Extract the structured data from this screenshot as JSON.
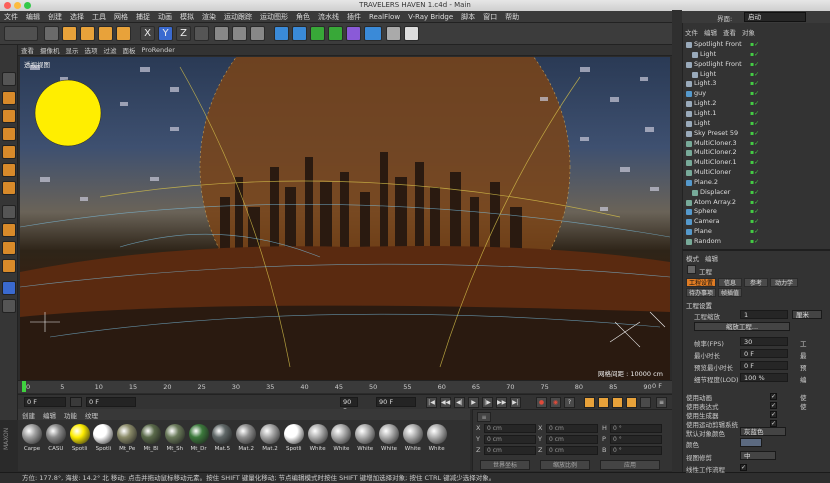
{
  "window": {
    "title": "TRAVELERS HAVEN 1.c4d - Main"
  },
  "menu": [
    "文件",
    "编辑",
    "创建",
    "选择",
    "工具",
    "网格",
    "捕捉",
    "动画",
    "模拟",
    "渲染",
    "运动跟踪",
    "运动图形",
    "角色",
    "流水线",
    "插件",
    "RealFlow",
    "V-Ray Bridge",
    "脚本",
    "窗口",
    "帮助"
  ],
  "interface": {
    "label": "界面:",
    "value": "启动"
  },
  "viewport": {
    "menu": [
      "查看",
      "摄像机",
      "显示",
      "选项",
      "过滤",
      "面板",
      "ProRender"
    ],
    "label": "透视视图",
    "grid_spacing": "网格间距 : 10000 cm"
  },
  "timeline": {
    "ticks": [
      "0",
      "5",
      "10",
      "15",
      "20",
      "25",
      "30",
      "35",
      "40",
      "45",
      "50",
      "55",
      "60",
      "65",
      "70",
      "75",
      "80",
      "85",
      "90"
    ],
    "end_label": "0 F",
    "current_frame": "0 F",
    "start_field": "0 F",
    "end_field": "90 F",
    "end_field2": "90 F"
  },
  "materials": {
    "tabs": [
      "创建",
      "编辑",
      "功能",
      "纹理"
    ],
    "items": [
      {
        "name": "Carpe",
        "color": "#a0a0a0"
      },
      {
        "name": "CASU",
        "color": "#8a8a8a"
      },
      {
        "name": "Spotli",
        "color": "#ffee00"
      },
      {
        "name": "Spotli",
        "color": "#ffffff"
      },
      {
        "name": "Mt_Pe",
        "color": "#8c8c6a"
      },
      {
        "name": "Mt_Bl",
        "color": "#5a6a4a"
      },
      {
        "name": "Mt_Sh",
        "color": "#6a7a5a"
      },
      {
        "name": "Mt_Dr",
        "color": "#3c7a3c"
      },
      {
        "name": "Mat.5",
        "color": "#606868"
      },
      {
        "name": "Mat.2",
        "color": "#909090"
      },
      {
        "name": "Mat.2",
        "color": "#a8a8a8"
      },
      {
        "name": "Spotli",
        "color": "#ffffff"
      },
      {
        "name": "White",
        "color": "#b0b0b0"
      },
      {
        "name": "White",
        "color": "#b0b0b0"
      },
      {
        "name": "White",
        "color": "#b0b0b0"
      },
      {
        "name": "White",
        "color": "#b0b0b0"
      },
      {
        "name": "White",
        "color": "#b0b0b0"
      },
      {
        "name": "White",
        "color": "#b0b0b0"
      }
    ],
    "brand": "MAXON"
  },
  "coordinates": {
    "rows": [
      {
        "a": "X",
        "av": "0 cm",
        "b": "X",
        "bv": "0 cm",
        "c": "H",
        "cv": "0 °"
      },
      {
        "a": "Y",
        "av": "0 cm",
        "b": "Y",
        "bv": "0 cm",
        "c": "P",
        "cv": "0 °"
      },
      {
        "a": "Z",
        "av": "0 cm",
        "b": "Z",
        "bv": "0 cm",
        "c": "B",
        "cv": "0 °"
      }
    ],
    "mode1": "世界坐标",
    "mode2": "缩放比例",
    "apply": "应用"
  },
  "status": "方位: 177.8°, 海拔: 14.2° 北   移动: 点击并拖动鼠标移动元素。按住 SHIFT 键量化移动; 节点编辑模式时按住 SHIFT 键增加选择对象; 按住 CTRL 键减少选择对象。",
  "objects": {
    "menu": [
      "文件",
      "编辑",
      "查看",
      "对象"
    ],
    "items": [
      {
        "name": "Spotlight Front",
        "indent": 0,
        "sel": false
      },
      {
        "name": "Light",
        "indent": 1,
        "sel": false
      },
      {
        "name": "Spotlight Front",
        "indent": 0,
        "sel": false
      },
      {
        "name": "Light",
        "indent": 1,
        "sel": false
      },
      {
        "name": "Light.3",
        "indent": 0,
        "sel": false
      },
      {
        "name": "guy",
        "indent": 0,
        "sel": false
      },
      {
        "name": "Light.2",
        "indent": 0,
        "sel": false
      },
      {
        "name": "Light.1",
        "indent": 0,
        "sel": false
      },
      {
        "name": "Light",
        "indent": 0,
        "sel": false
      },
      {
        "name": "Sky Preset 59",
        "indent": 0,
        "sel": false
      },
      {
        "name": "MultiCloner.3",
        "indent": 0,
        "sel": false
      },
      {
        "name": "MultiCloner.2",
        "indent": 0,
        "sel": false
      },
      {
        "name": "MultiCloner.1",
        "indent": 0,
        "sel": false
      },
      {
        "name": "MultiCloner",
        "indent": 0,
        "sel": false
      },
      {
        "name": "Plane.2",
        "indent": 0,
        "sel": false
      },
      {
        "name": "Displacer",
        "indent": 1,
        "sel": false
      },
      {
        "name": "Atom Array.2",
        "indent": 0,
        "sel": false
      },
      {
        "name": "Sphere",
        "indent": 0,
        "sel": false
      },
      {
        "name": "Camera",
        "indent": 0,
        "sel": false
      },
      {
        "name": "Plane",
        "indent": 0,
        "sel": false
      },
      {
        "name": "Random",
        "indent": 0,
        "sel": false
      }
    ]
  },
  "attributes": {
    "menu": [
      "模式",
      "编辑"
    ],
    "title": "工程",
    "tabs": [
      "工程设置",
      "信息",
      "参考",
      "动力学",
      "待办事项",
      "帧插值"
    ],
    "section": "工程设置",
    "scale_label": "工程缩放",
    "scale_value": "1",
    "scale_unit": "厘米",
    "scale_button": "缩放工程...",
    "fields": [
      {
        "label": "帧率(FPS)",
        "value": "30",
        "side": "工"
      },
      {
        "label": "最小时长",
        "value": "0 F",
        "side": "最"
      },
      {
        "label": "预览最小时长",
        "value": "0 F",
        "side": "预"
      },
      {
        "label": "细节程度(LOD)",
        "value": "100 %",
        "side": "编"
      }
    ],
    "checks": [
      {
        "label": "使用动画",
        "side": "使"
      },
      {
        "label": "使用表达式",
        "side": "使"
      },
      {
        "label": "使用生成器",
        "side": ""
      },
      {
        "label": "使用运动剪辑系统",
        "side": ""
      }
    ],
    "default_color_label": "默认对象颜色",
    "default_color_value": "灰蓝色",
    "color_label": "颜色",
    "view_clip_label": "视图修剪",
    "view_clip_value": "中",
    "linear_label": "线性工作流程"
  }
}
